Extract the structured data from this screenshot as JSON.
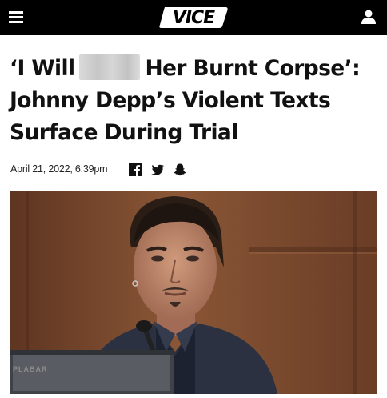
{
  "header": {
    "logo_text": "VICE",
    "menu_icon": "hamburger-menu-icon",
    "user_icon": "user-icon"
  },
  "article": {
    "headline_part1": "‘I Will",
    "headline_part2": "Her Burnt Corpse’: Johnny Depp’s Violent Texts Surface During Trial",
    "dateline": "April 21, 2022, 6:39pm",
    "share_icons": [
      "facebook-icon",
      "twitter-icon",
      "snapchat-icon"
    ],
    "photo_plate_text": "PLABAR"
  },
  "colors": {
    "header_bg": "#000000",
    "headline": "#111111",
    "background": "#ffffff"
  }
}
